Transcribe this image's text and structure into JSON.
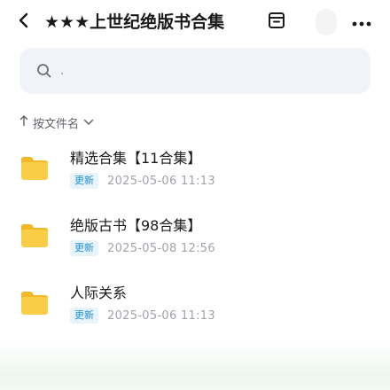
{
  "header": {
    "back_icon": "chevron-left-icon",
    "title": "★★★上世纪绝版书合集",
    "archive_icon": "archive-box-icon",
    "more_icon": "more-horizontal-icon"
  },
  "search": {
    "icon": "search-icon",
    "placeholder": "."
  },
  "sort": {
    "icon": "sort-arrow-up-icon",
    "label": "按文件名",
    "chevron_icon": "chevron-down-icon"
  },
  "files": [
    {
      "icon": "folder-icon",
      "name": "精选合集【11合集】",
      "badge": "更新",
      "date": "2025-05-06  11:13"
    },
    {
      "icon": "folder-icon",
      "name": "绝版古书【98合集】",
      "badge": "更新",
      "date": "2025-05-08  12:56"
    },
    {
      "icon": "folder-icon",
      "name": "人际关系",
      "badge": "更新",
      "date": "2025-05-06  11:13"
    }
  ],
  "colors": {
    "folder": "#f7c83b",
    "badge_text": "#1e8fd8",
    "badge_bg": "#e8f4fb",
    "search_bg": "#f0f3f8"
  }
}
